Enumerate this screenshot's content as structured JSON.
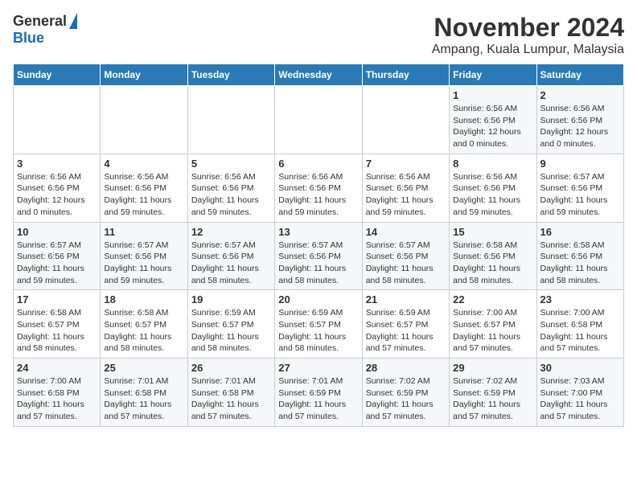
{
  "logo": {
    "general": "General",
    "blue": "Blue"
  },
  "title": "November 2024",
  "subtitle": "Ampang, Kuala Lumpur, Malaysia",
  "days_of_week": [
    "Sunday",
    "Monday",
    "Tuesday",
    "Wednesday",
    "Thursday",
    "Friday",
    "Saturday"
  ],
  "weeks": [
    [
      {
        "day": "",
        "info": ""
      },
      {
        "day": "",
        "info": ""
      },
      {
        "day": "",
        "info": ""
      },
      {
        "day": "",
        "info": ""
      },
      {
        "day": "",
        "info": ""
      },
      {
        "day": "1",
        "info": "Sunrise: 6:56 AM\nSunset: 6:56 PM\nDaylight: 12 hours and 0 minutes."
      },
      {
        "day": "2",
        "info": "Sunrise: 6:56 AM\nSunset: 6:56 PM\nDaylight: 12 hours and 0 minutes."
      }
    ],
    [
      {
        "day": "3",
        "info": "Sunrise: 6:56 AM\nSunset: 6:56 PM\nDaylight: 12 hours and 0 minutes."
      },
      {
        "day": "4",
        "info": "Sunrise: 6:56 AM\nSunset: 6:56 PM\nDaylight: 11 hours and 59 minutes."
      },
      {
        "day": "5",
        "info": "Sunrise: 6:56 AM\nSunset: 6:56 PM\nDaylight: 11 hours and 59 minutes."
      },
      {
        "day": "6",
        "info": "Sunrise: 6:56 AM\nSunset: 6:56 PM\nDaylight: 11 hours and 59 minutes."
      },
      {
        "day": "7",
        "info": "Sunrise: 6:56 AM\nSunset: 6:56 PM\nDaylight: 11 hours and 59 minutes."
      },
      {
        "day": "8",
        "info": "Sunrise: 6:56 AM\nSunset: 6:56 PM\nDaylight: 11 hours and 59 minutes."
      },
      {
        "day": "9",
        "info": "Sunrise: 6:57 AM\nSunset: 6:56 PM\nDaylight: 11 hours and 59 minutes."
      }
    ],
    [
      {
        "day": "10",
        "info": "Sunrise: 6:57 AM\nSunset: 6:56 PM\nDaylight: 11 hours and 59 minutes."
      },
      {
        "day": "11",
        "info": "Sunrise: 6:57 AM\nSunset: 6:56 PM\nDaylight: 11 hours and 59 minutes."
      },
      {
        "day": "12",
        "info": "Sunrise: 6:57 AM\nSunset: 6:56 PM\nDaylight: 11 hours and 58 minutes."
      },
      {
        "day": "13",
        "info": "Sunrise: 6:57 AM\nSunset: 6:56 PM\nDaylight: 11 hours and 58 minutes."
      },
      {
        "day": "14",
        "info": "Sunrise: 6:57 AM\nSunset: 6:56 PM\nDaylight: 11 hours and 58 minutes."
      },
      {
        "day": "15",
        "info": "Sunrise: 6:58 AM\nSunset: 6:56 PM\nDaylight: 11 hours and 58 minutes."
      },
      {
        "day": "16",
        "info": "Sunrise: 6:58 AM\nSunset: 6:56 PM\nDaylight: 11 hours and 58 minutes."
      }
    ],
    [
      {
        "day": "17",
        "info": "Sunrise: 6:58 AM\nSunset: 6:57 PM\nDaylight: 11 hours and 58 minutes."
      },
      {
        "day": "18",
        "info": "Sunrise: 6:58 AM\nSunset: 6:57 PM\nDaylight: 11 hours and 58 minutes."
      },
      {
        "day": "19",
        "info": "Sunrise: 6:59 AM\nSunset: 6:57 PM\nDaylight: 11 hours and 58 minutes."
      },
      {
        "day": "20",
        "info": "Sunrise: 6:59 AM\nSunset: 6:57 PM\nDaylight: 11 hours and 58 minutes."
      },
      {
        "day": "21",
        "info": "Sunrise: 6:59 AM\nSunset: 6:57 PM\nDaylight: 11 hours and 57 minutes."
      },
      {
        "day": "22",
        "info": "Sunrise: 7:00 AM\nSunset: 6:57 PM\nDaylight: 11 hours and 57 minutes."
      },
      {
        "day": "23",
        "info": "Sunrise: 7:00 AM\nSunset: 6:58 PM\nDaylight: 11 hours and 57 minutes."
      }
    ],
    [
      {
        "day": "24",
        "info": "Sunrise: 7:00 AM\nSunset: 6:58 PM\nDaylight: 11 hours and 57 minutes."
      },
      {
        "day": "25",
        "info": "Sunrise: 7:01 AM\nSunset: 6:58 PM\nDaylight: 11 hours and 57 minutes."
      },
      {
        "day": "26",
        "info": "Sunrise: 7:01 AM\nSunset: 6:58 PM\nDaylight: 11 hours and 57 minutes."
      },
      {
        "day": "27",
        "info": "Sunrise: 7:01 AM\nSunset: 6:59 PM\nDaylight: 11 hours and 57 minutes."
      },
      {
        "day": "28",
        "info": "Sunrise: 7:02 AM\nSunset: 6:59 PM\nDaylight: 11 hours and 57 minutes."
      },
      {
        "day": "29",
        "info": "Sunrise: 7:02 AM\nSunset: 6:59 PM\nDaylight: 11 hours and 57 minutes."
      },
      {
        "day": "30",
        "info": "Sunrise: 7:03 AM\nSunset: 7:00 PM\nDaylight: 11 hours and 57 minutes."
      }
    ]
  ]
}
